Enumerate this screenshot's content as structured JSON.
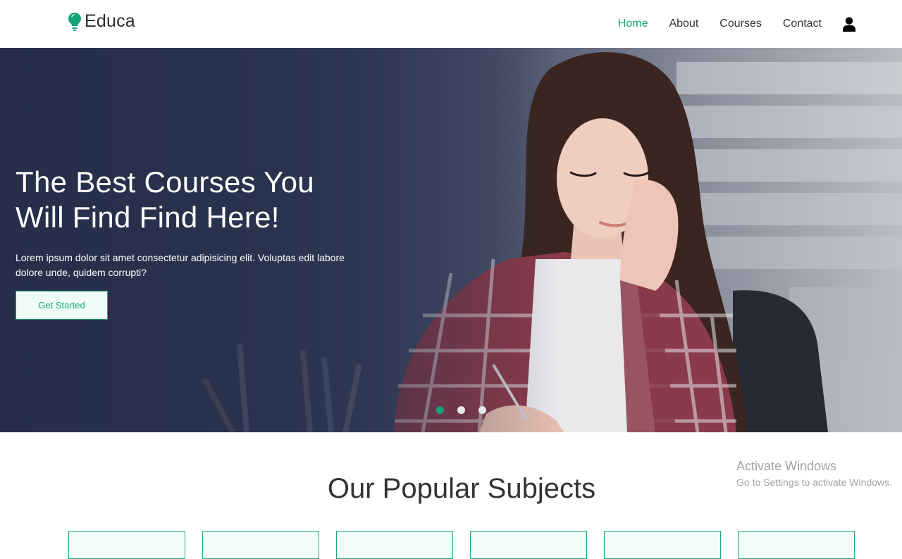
{
  "header": {
    "brand": "Educa",
    "nav": {
      "home": "Home",
      "about": "About",
      "courses": "Courses",
      "contact": "Contact"
    },
    "active_item": "Home"
  },
  "hero": {
    "title_line1": "The Best Courses You",
    "title_line2": "Will Find Find Here!",
    "subtitle_line1": "Lorem ipsum dolor sit amet consectetur adipisicing elit. Voluptas edit labore",
    "subtitle_line2": "dolore unde, quidem corrupti?",
    "cta_label": "Get Started",
    "slides_count": 3,
    "active_slide": 1
  },
  "subjects": {
    "title": "Our Popular Subjects",
    "cards_visible": 6
  },
  "watermark": {
    "title": "Activate Windows",
    "subtitle": "Go to Settings to activate Windows."
  },
  "colors": {
    "accent": "#16a37c",
    "text_dark": "#333333",
    "hero_overlay": "#252d48",
    "card_bg": "#f2fcf9"
  },
  "icons": {
    "logo": "lightbulb-icon",
    "user": "user-icon"
  }
}
